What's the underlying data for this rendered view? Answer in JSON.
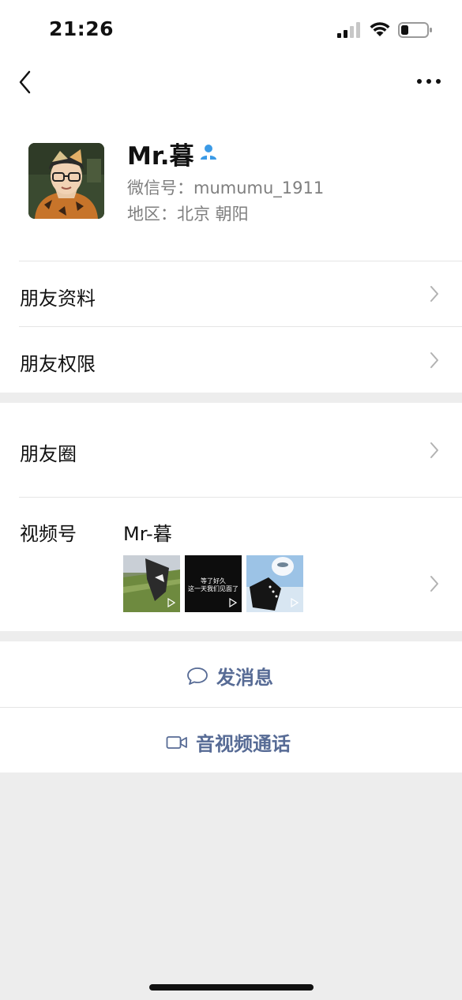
{
  "status_bar": {
    "time": "21:26"
  },
  "profile": {
    "name": "Mr.暮",
    "wechat_id": "微信号：mumumu_1911",
    "region": "地区：北京 朝阳"
  },
  "menu": {
    "friend_info": "朋友资料",
    "friend_permissions": "朋友权限",
    "moments": "朋友圈",
    "channels_label": "视频号",
    "channels_name": "Mr-暮"
  },
  "channel_thumbs": [
    {
      "caption": ""
    },
    {
      "caption_line1": "等了好久",
      "caption_line2": "这一天我们见面了"
    },
    {
      "caption": ""
    }
  ],
  "actions": {
    "send_message": "发消息",
    "video_call": "音视频通话"
  },
  "colors": {
    "link_blue": "#576b95",
    "contact_blue": "#3b9ae6",
    "page_gray": "#ededed"
  },
  "icons": [
    "back-icon",
    "more-icon",
    "contact-icon",
    "chevron-right-icon",
    "message-bubble-icon",
    "video-camera-icon",
    "signal-icon",
    "wifi-icon",
    "battery-icon"
  ]
}
